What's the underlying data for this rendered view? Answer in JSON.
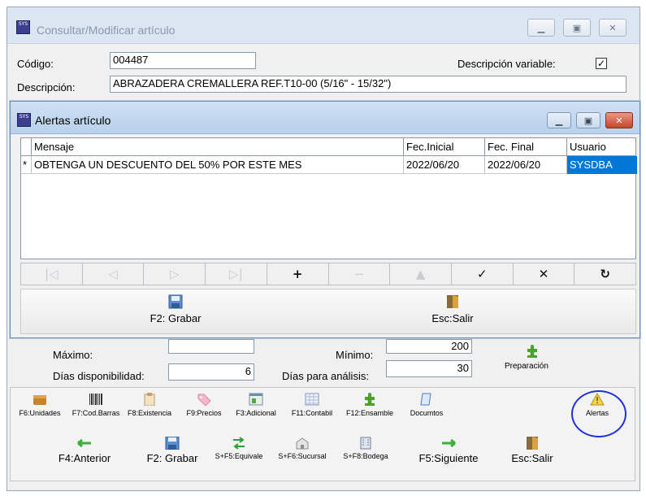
{
  "main_window": {
    "title": "Consultar/Modificar artículo",
    "app_icon_text": "SYS",
    "codigo_label": "Código:",
    "codigo_value": "004487",
    "desc_variable_label": "Descripción variable:",
    "desc_variable_checked": "✓",
    "descripcion_label": "Descripción:",
    "descripcion_value": "ABRAZADERA CREMALLERA REF.T10-00  (5/16\" - 15/32\")",
    "maximo_label": "Máximo:",
    "maximo_value": "",
    "minimo_label": "Mínimo:",
    "minimo_value": "200",
    "dias_disp_label": "Días disponibilidad:",
    "dias_disp_value": "6",
    "dias_analisis_label": "Días para análisis:",
    "dias_analisis_value": "30",
    "preparacion_label": "Preparación"
  },
  "alert_window": {
    "title": "Alertas artículo",
    "columns": [
      "Mensaje",
      "Fec.Inicial",
      "Fec. Final",
      "Usuario"
    ],
    "rows": [
      {
        "marker": "*",
        "mensaje": "OBTENGA UN DESCUENTO DEL 50% POR ESTE MES",
        "fec_inicial": "2022/06/20",
        "fec_final": "2022/06/20",
        "usuario": "SYSDBA"
      }
    ],
    "nav_buttons": [
      "|◁",
      "◁",
      "▷",
      "▷|",
      "+",
      "−",
      "▲",
      "✓",
      "✕",
      "↻"
    ],
    "save_label": "F2: Grabar",
    "exit_label": "Esc:Salir"
  },
  "toolbar_row1": [
    {
      "label": "F6:Unidades",
      "icon": "box-icon"
    },
    {
      "label": "F7:Cod.Barras",
      "icon": "barcode-icon"
    },
    {
      "label": "F8:Existencia",
      "icon": "clipboard-icon"
    },
    {
      "label": "F9:Precios",
      "icon": "tag-icon"
    },
    {
      "label": "F3:Adicional",
      "icon": "window-icon"
    },
    {
      "label": "F11:Contabil",
      "icon": "ledger-icon"
    },
    {
      "label": "F12:Ensamble",
      "icon": "puzzle-icon"
    },
    {
      "label": "Documtos",
      "icon": "document-icon"
    },
    {
      "label": "Alertas",
      "icon": "warning-icon"
    }
  ],
  "toolbar_row2": [
    {
      "label": "F4:Anterior",
      "icon": "arrow-left-icon"
    },
    {
      "label": "F2: Grabar",
      "icon": "save-icon"
    },
    {
      "label": "S+F5:Equivale",
      "icon": "equivalent-icon"
    },
    {
      "label": "S+F6:Sucursal",
      "icon": "branch-icon"
    },
    {
      "label": "S+F8:Bodega",
      "icon": "warehouse-icon"
    },
    {
      "label": "F5:Siguiente",
      "icon": "arrow-right-icon"
    },
    {
      "label": "Esc:Salir",
      "icon": "exit-door-icon"
    }
  ],
  "colors": {
    "selection": "#0078d7",
    "highlight_ring": "#1f30d6",
    "titlebar_active": "#b9d1ec"
  }
}
